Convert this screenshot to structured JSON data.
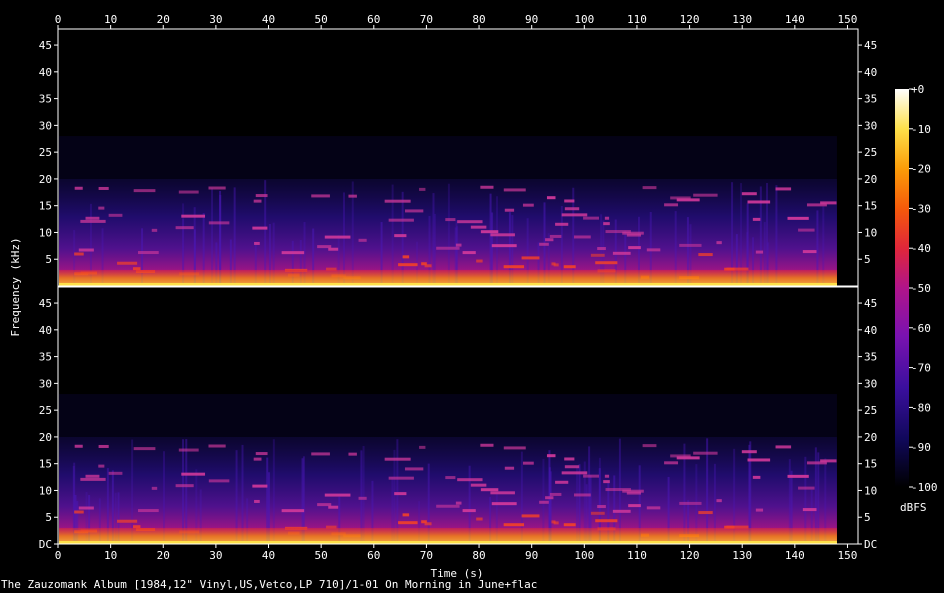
{
  "caption": "The Zauzomank Album [1984,12\" Vinyl,US,Vetco,LP 710]/1-01 On Morning in June+flac",
  "chart_data": {
    "type": "heatmap",
    "title": "",
    "xlabel": "Time (s)",
    "ylabel": "Frequency (kHz)",
    "colorbar_label": "dBFS",
    "xlim": [
      0,
      152
    ],
    "ylim_khz": [
      0,
      48
    ],
    "time_ticks": [
      0,
      10,
      20,
      30,
      40,
      50,
      60,
      70,
      80,
      90,
      100,
      110,
      120,
      130,
      140,
      150
    ],
    "freq_ticks_top": [
      "5",
      "10",
      "15",
      "20",
      "25",
      "30",
      "35",
      "40",
      "45"
    ],
    "freq_ticks_bottom": [
      "DC",
      "5",
      "10",
      "15",
      "20",
      "25",
      "30",
      "35",
      "40",
      "45"
    ],
    "colorbar_ticks": [
      "+0",
      "-10",
      "-20",
      "-30",
      "-40",
      "-50",
      "-60",
      "-70",
      "-80",
      "-90",
      "-100"
    ],
    "channels": [
      {
        "name": "",
        "content_cutoff_khz": 20,
        "audio_end_s": 148
      },
      {
        "name": "",
        "content_cutoff_khz": 20,
        "audio_end_s": 148
      }
    ],
    "colormap": [
      "#000000",
      "#10085a",
      "#3b0f9e",
      "#7a12b0",
      "#b0148a",
      "#e0263a",
      "#f55a0a",
      "#fb9c08",
      "#fde04a",
      "#ffffff"
    ]
  }
}
